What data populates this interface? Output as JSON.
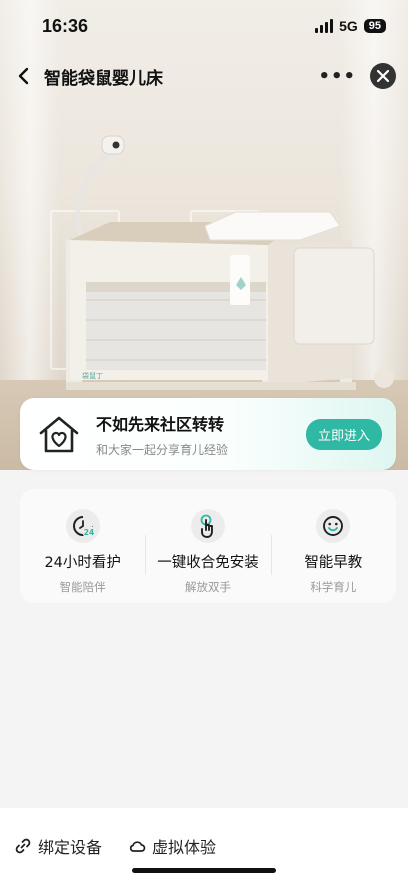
{
  "status": {
    "time": "16:36",
    "network": "5G",
    "battery": "95"
  },
  "nav": {
    "title": "智能袋鼠婴儿床",
    "more_icon": "more-icon",
    "close_icon": "close-icon"
  },
  "hero": {
    "brand_text": "袋鼠丁"
  },
  "community": {
    "title": "不如先来社区转转",
    "subtitle": "和大家一起分享育儿经验",
    "button": "立即进入"
  },
  "features": [
    {
      "icon": "clock-24-icon",
      "title": "24小时看护",
      "subtitle": "智能陪伴",
      "icon_text": "24"
    },
    {
      "icon": "tap-hand-icon",
      "title": "一键收合免安装",
      "subtitle": "解放双手"
    },
    {
      "icon": "smile-face-icon",
      "title": "智能早教",
      "subtitle": "科学育儿"
    }
  ],
  "bottom": {
    "bind_device": "绑定设备",
    "virtual_experience": "虚拟体验"
  },
  "colors": {
    "accent": "#2fb8a4",
    "text": "#111111",
    "subtext": "#999999"
  }
}
